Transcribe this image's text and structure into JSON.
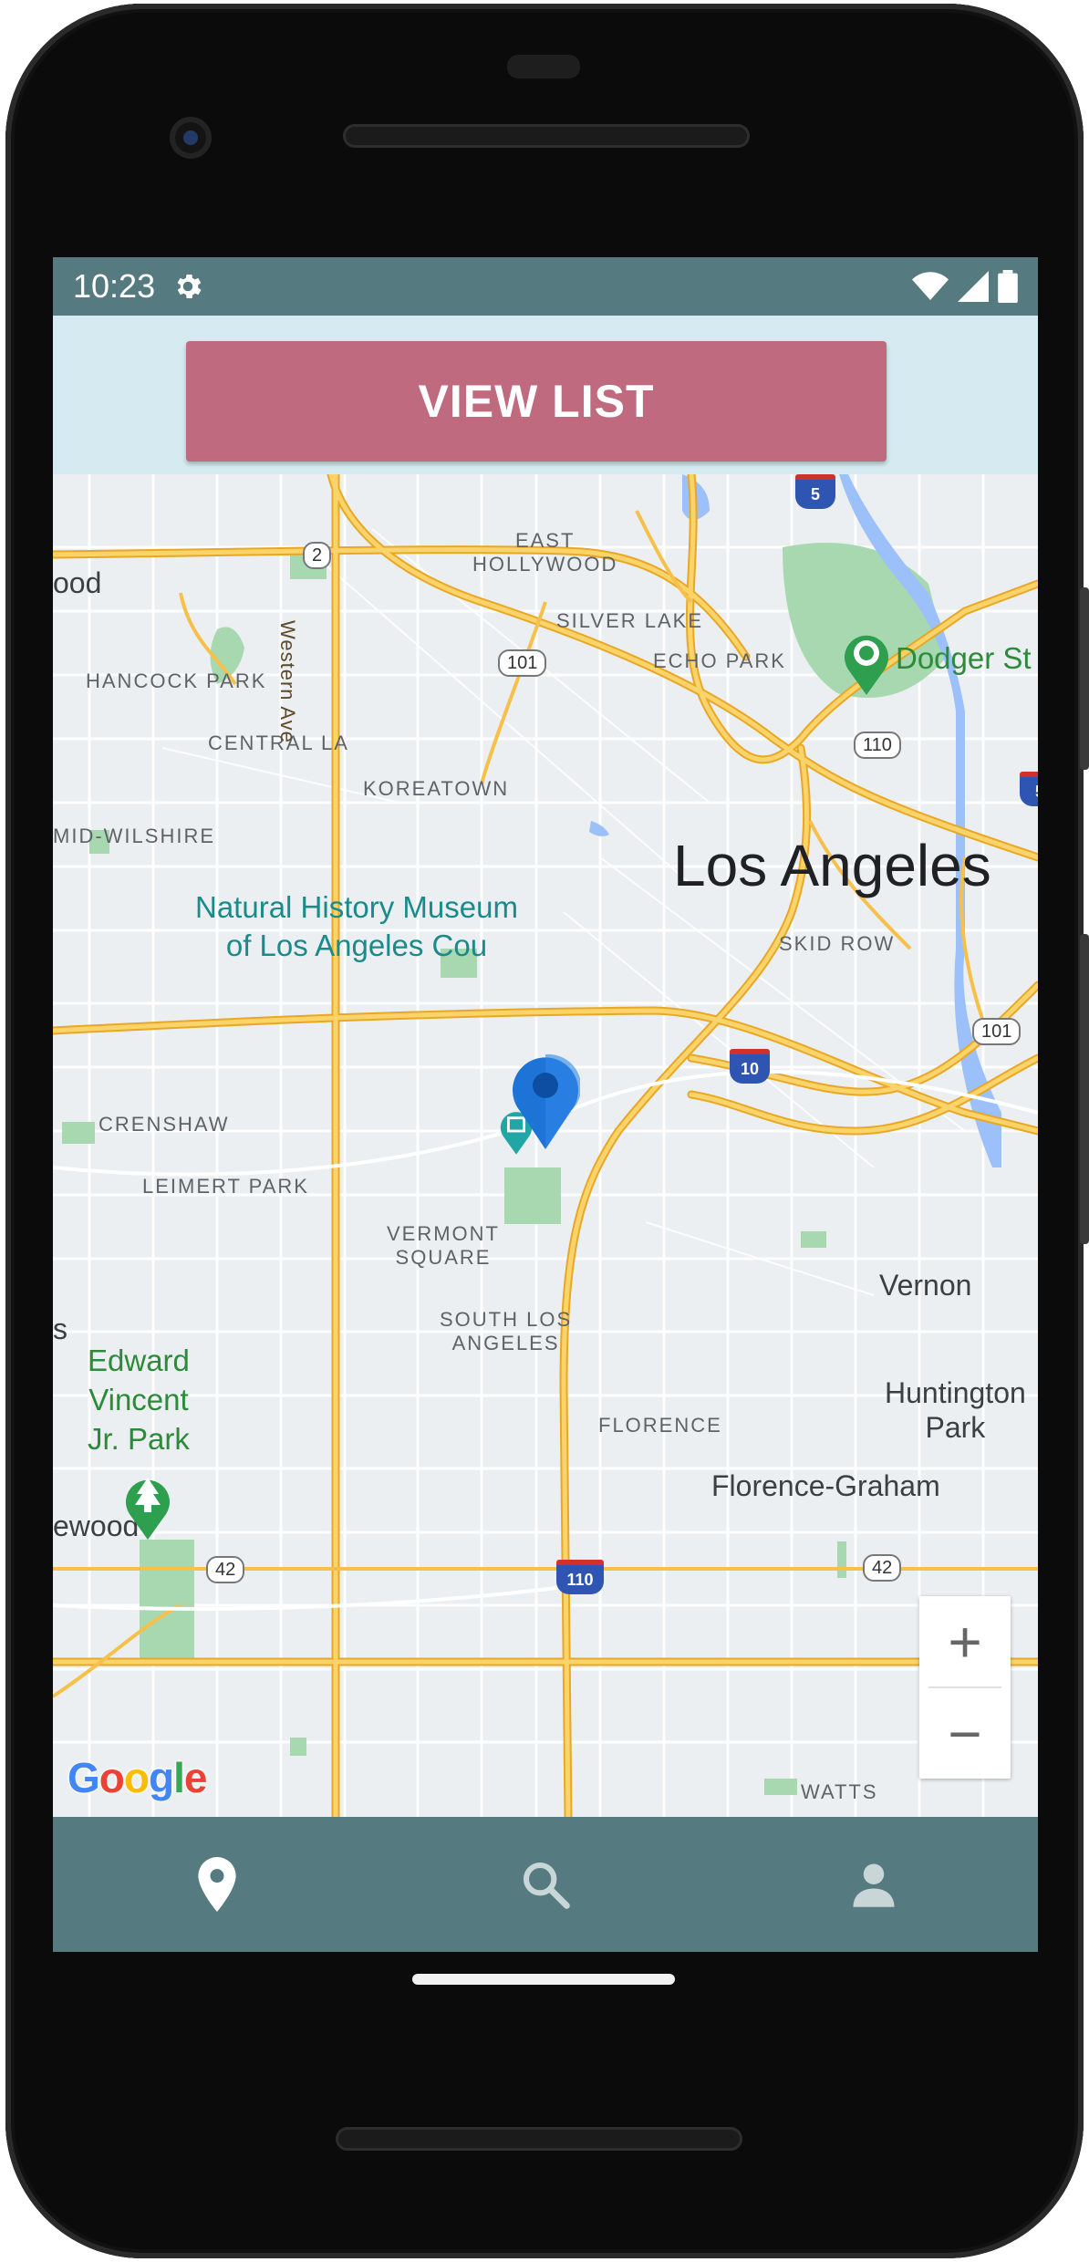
{
  "status_bar": {
    "time": "10:23"
  },
  "header": {
    "view_list_label": "VIEW LIST"
  },
  "map": {
    "city": "Los Angeles",
    "neighborhoods": {
      "east_hollywood_1": "EAST",
      "east_hollywood_2": "HOLLYWOOD",
      "silver_lake": "SILVER LAKE",
      "echo_park": "ECHO PARK",
      "hancock_park": "HANCOCK PARK",
      "central_la": "CENTRAL LA",
      "koreatown": "KOREATOWN",
      "mid_wilshire": "MID-WILSHIRE",
      "skid_row": "SKID ROW",
      "crenshaw": "CRENSHAW",
      "leimert_park": "LEIMERT PARK",
      "vermont_square_1": "VERMONT",
      "vermont_square_2": "SQUARE",
      "south_la_1": "SOUTH LOS",
      "south_la_2": "ANGELES",
      "florence": "FLORENCE",
      "watts": "WATTS"
    },
    "places": {
      "dodger_stadium": "Dodger St",
      "museum_line1": "Natural History Museum",
      "museum_line2": "of Los Angeles Cou",
      "park_line1": "Edward",
      "park_line2": "Vincent",
      "park_line3": "Jr. Park",
      "vernon": "Vernon",
      "huntington_1": "Huntington",
      "huntington_2": "Park",
      "florence_graham": "Florence-Graham",
      "inglewood_partial": "ewood",
      "hollywood_partial": "ood",
      "edge_s": "s"
    },
    "streets": {
      "western_ave": "Western Ave"
    },
    "route_shields": {
      "r2": "2",
      "r5": "5",
      "r5b": "5",
      "r101": "101",
      "r101b": "101",
      "r110": "110",
      "r110b": "110",
      "r10": "10",
      "r42": "42",
      "r42b": "42"
    },
    "logo": "Google",
    "zoom_in": "+",
    "zoom_out": "−"
  },
  "bottom_nav": {
    "items": [
      {
        "icon": "map-pin-icon",
        "active": true
      },
      {
        "icon": "search-icon",
        "active": false
      },
      {
        "icon": "person-icon",
        "active": false
      }
    ]
  },
  "colors": {
    "status_bar": "#557a80",
    "header_band": "#d6eaf2",
    "button": "#c06a80",
    "bottom_nav": "#557a80",
    "road_major": "#f6c04a",
    "park": "#a8d8b0"
  }
}
